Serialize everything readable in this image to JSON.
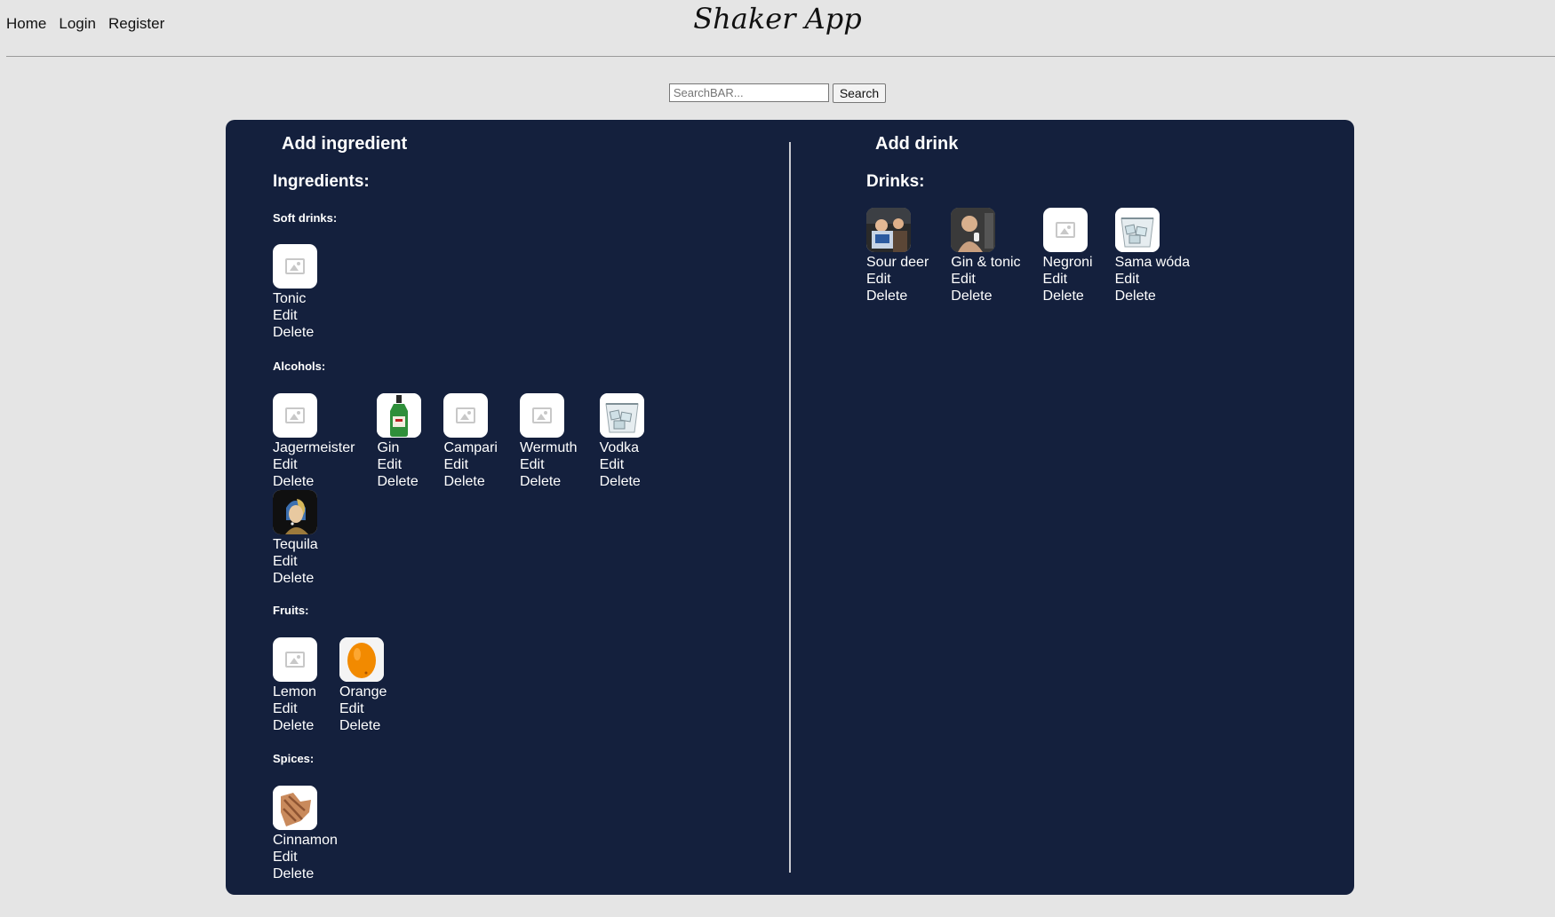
{
  "nav": {
    "home": "Home",
    "login": "Login",
    "register": "Register"
  },
  "brand": "Shaker App",
  "search": {
    "placeholder": "SearchBAR...",
    "button": "Search"
  },
  "ingredients": {
    "add_label": "Add ingredient",
    "title": "Ingredients:",
    "categories": [
      {
        "label": "Soft drinks:",
        "items": [
          {
            "name": "Tonic",
            "image": "placeholder-icon"
          }
        ]
      },
      {
        "label": "Alcohols:",
        "items": [
          {
            "name": "Jagermeister",
            "image": "placeholder-icon"
          },
          {
            "name": "Gin",
            "image": "gin-bottle-photo"
          },
          {
            "name": "Campari",
            "image": "placeholder-icon"
          },
          {
            "name": "Wermuth",
            "image": "placeholder-icon"
          },
          {
            "name": "Vodka",
            "image": "glass-ice-photo"
          },
          {
            "name": "Tequila",
            "image": "painting-portrait-photo"
          }
        ]
      },
      {
        "label": "Fruits:",
        "items": [
          {
            "name": "Lemon",
            "image": "placeholder-icon"
          },
          {
            "name": "Orange",
            "image": "orange-photo"
          }
        ]
      },
      {
        "label": "Spices:",
        "items": [
          {
            "name": "Cinnamon",
            "image": "cinnamon-photo"
          }
        ]
      }
    ]
  },
  "drinks": {
    "add_label": "Add drink",
    "title": "Drinks:",
    "items": [
      {
        "name": "Sour deer",
        "image": "photo-people"
      },
      {
        "name": "Gin & tonic",
        "image": "photo-person"
      },
      {
        "name": "Negroni",
        "image": "placeholder-icon"
      },
      {
        "name": "Sama wóda",
        "image": "glass-ice-photo"
      }
    ]
  },
  "actions": {
    "edit": "Edit",
    "delete": "Delete"
  },
  "colors": {
    "page_bg": "#e5e5e5",
    "panel_bg": "#14203d",
    "text_on_panel": "#ffffff"
  }
}
